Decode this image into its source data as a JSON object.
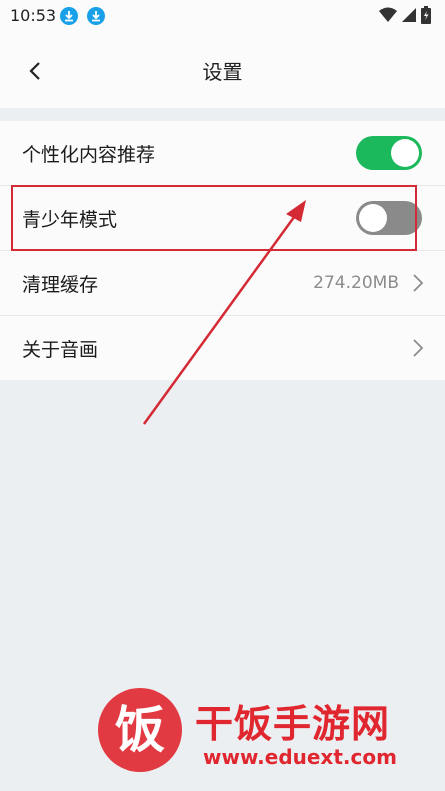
{
  "status_bar": {
    "time": "10:53"
  },
  "header": {
    "title": "设置"
  },
  "settings": [
    {
      "label": "个性化内容推荐",
      "type": "toggle",
      "enabled": true
    },
    {
      "label": "青少年模式",
      "type": "toggle",
      "enabled": false
    },
    {
      "label": "清理缓存",
      "type": "link",
      "value": "274.20MB"
    },
    {
      "label": "关于音画",
      "type": "link"
    }
  ],
  "watermark": {
    "logo": "饭",
    "title": "干饭手游网",
    "url": "www.eduext.com"
  },
  "colors": {
    "accent_green": "#1cb85c",
    "toggle_off": "#8a8a8a",
    "highlight_red": "#d42a35",
    "download_blue": "#1aa0e8"
  },
  "icons": [
    "download-icon",
    "wifi-icon",
    "signal-icon",
    "battery-icon",
    "back-arrow-icon",
    "chevron-right-icon"
  ]
}
